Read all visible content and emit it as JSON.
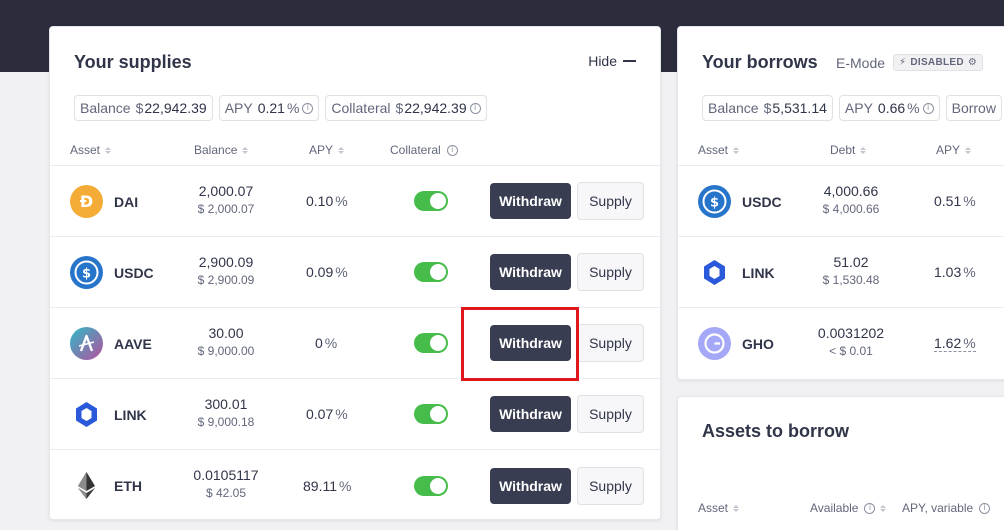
{
  "supplies": {
    "title": "Your supplies",
    "hide_label": "Hide",
    "summary": {
      "balance_label": "Balance",
      "balance_currency": "$",
      "balance_value": "22,942.39",
      "apy_label": "APY",
      "apy_value": "0.21",
      "apy_unit": "%",
      "collateral_label": "Collateral",
      "collateral_currency": "$",
      "collateral_value": "22,942.39"
    },
    "columns": {
      "asset": "Asset",
      "balance": "Balance",
      "apy": "APY",
      "collateral": "Collateral"
    },
    "withdraw_label": "Withdraw",
    "supply_label": "Supply",
    "rows": [
      {
        "symbol": "DAI",
        "balance": "2,000.07",
        "usd": "$ 2,000.07",
        "apy": "0.10",
        "apy_unit": "%",
        "icon": "dai-token-icon",
        "color": "#f5ac37"
      },
      {
        "symbol": "USDC",
        "balance": "2,900.09",
        "usd": "$ 2,900.09",
        "apy": "0.09",
        "apy_unit": "%",
        "icon": "usdc-token-icon",
        "color": "#2775ca"
      },
      {
        "symbol": "AAVE",
        "balance": "30.00",
        "usd": "$ 9,000.00",
        "apy": "0",
        "apy_unit": "%",
        "icon": "aave-token-icon",
        "color": "#b6509e"
      },
      {
        "symbol": "LINK",
        "balance": "300.01",
        "usd": "$ 9,000.18",
        "apy": "0.07",
        "apy_unit": "%",
        "icon": "link-token-icon",
        "color": "#2a5ada"
      },
      {
        "symbol": "ETH",
        "balance": "0.0105117",
        "usd": "$ 42.05",
        "apy": "89.11",
        "apy_unit": "%",
        "icon": "eth-token-icon",
        "color": "#343434"
      }
    ]
  },
  "borrows": {
    "title": "Your borrows",
    "emode_label": "E-Mode",
    "emode_status": "DISABLED",
    "summary": {
      "balance_label": "Balance",
      "balance_currency": "$",
      "balance_value": "5,531.14",
      "apy_label": "APY",
      "apy_value": "0.66",
      "apy_unit": "%",
      "power_label": "Borrow"
    },
    "columns": {
      "asset": "Asset",
      "debt": "Debt",
      "apy": "APY"
    },
    "rows": [
      {
        "symbol": "USDC",
        "debt": "4,000.66",
        "usd": "$ 4,000.66",
        "apy": "0.51",
        "apy_unit": "%",
        "icon": "usdc-token-icon"
      },
      {
        "symbol": "LINK",
        "debt": "51.02",
        "usd": "$ 1,530.48",
        "apy": "1.03",
        "apy_unit": "%",
        "icon": "link-token-icon"
      },
      {
        "symbol": "GHO",
        "debt": "0.0031202",
        "usd": "< $ 0.01",
        "apy": "1.62",
        "apy_unit": "%",
        "icon": "gho-token-icon"
      }
    ]
  },
  "assets_to_borrow": {
    "title": "Assets to borrow",
    "columns": {
      "asset": "Asset",
      "available": "Available",
      "apy_variable": "APY, variable"
    }
  },
  "colors": {
    "topbar": "#2b2d3c",
    "withdraw_button": "#383d51",
    "toggle_on": "#46bc4b",
    "highlight": "#e1171e"
  }
}
